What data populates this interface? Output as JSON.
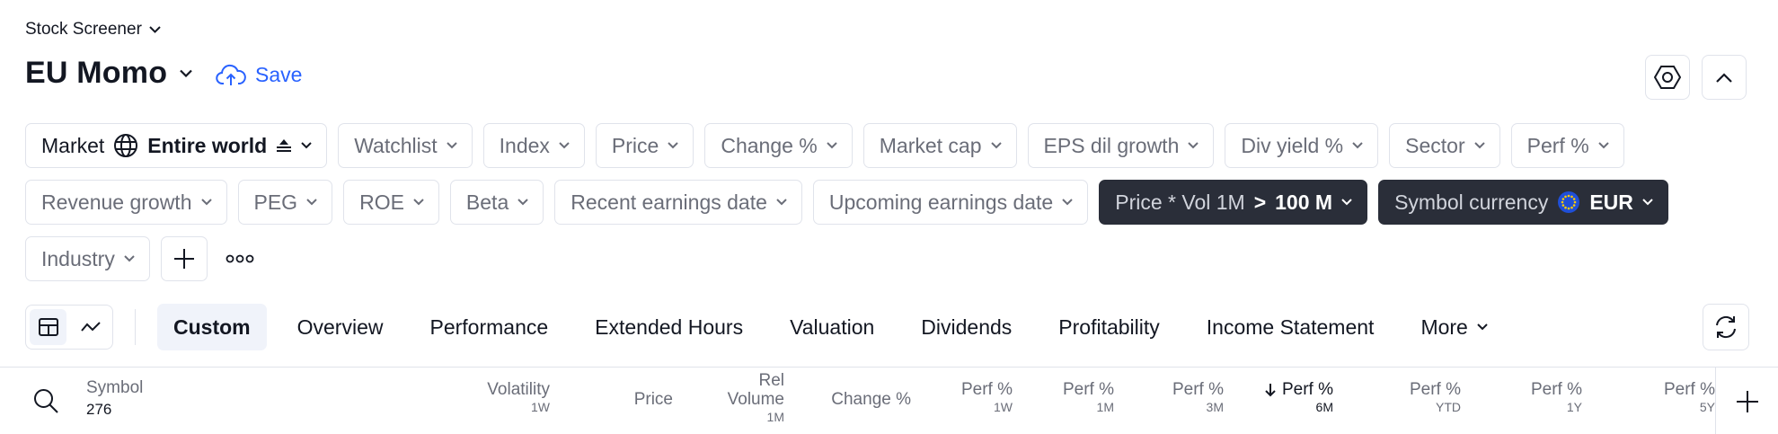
{
  "screener": {
    "title": "Stock Screener",
    "screen_name": "EU Momo",
    "save_label": "Save"
  },
  "filters": {
    "market": {
      "label": "Market",
      "value": "Entire world"
    },
    "row1": [
      "Watchlist",
      "Index",
      "Price",
      "Change %",
      "Market cap",
      "EPS dil growth",
      "Div yield %",
      "Sector",
      "Perf %"
    ],
    "row2": [
      "Revenue growth",
      "PEG",
      "ROE",
      "Beta",
      "Recent earnings date",
      "Upcoming earnings date"
    ],
    "price_vol": {
      "label": "Price * Vol 1M",
      "operator": ">",
      "value": "100 M"
    },
    "currency": {
      "label": "Symbol currency",
      "value": "EUR"
    },
    "industry": "Industry"
  },
  "tabs": [
    "Custom",
    "Overview",
    "Performance",
    "Extended Hours",
    "Valuation",
    "Dividends",
    "Profitability",
    "Income Statement",
    "More"
  ],
  "active_tab": "Custom",
  "table": {
    "symbol_header": "Symbol",
    "symbol_count": "276",
    "columns": [
      {
        "label": "Volatility",
        "sub": "1W"
      },
      {
        "label": "Price",
        "sub": ""
      },
      {
        "label": "Rel Volume",
        "sub": "1M"
      },
      {
        "label": "Change %",
        "sub": ""
      },
      {
        "label": "Perf %",
        "sub": "1W"
      },
      {
        "label": "Perf %",
        "sub": "1M"
      },
      {
        "label": "Perf %",
        "sub": "3M"
      },
      {
        "label": "Perf %",
        "sub": "6M"
      },
      {
        "label": "Perf %",
        "sub": "YTD"
      },
      {
        "label": "Perf %",
        "sub": "1Y"
      },
      {
        "label": "Perf %",
        "sub": "5Y"
      }
    ],
    "sorted_column": "Perf % 6M",
    "sort_direction": "descending"
  },
  "colors": {
    "accent": "#2962ff",
    "dark_chip": "#2a2e39",
    "border": "#e0e3eb",
    "muted_text": "#6a6d78",
    "eu_blue": "#1f4fd8",
    "eu_star": "#ffcc00"
  }
}
